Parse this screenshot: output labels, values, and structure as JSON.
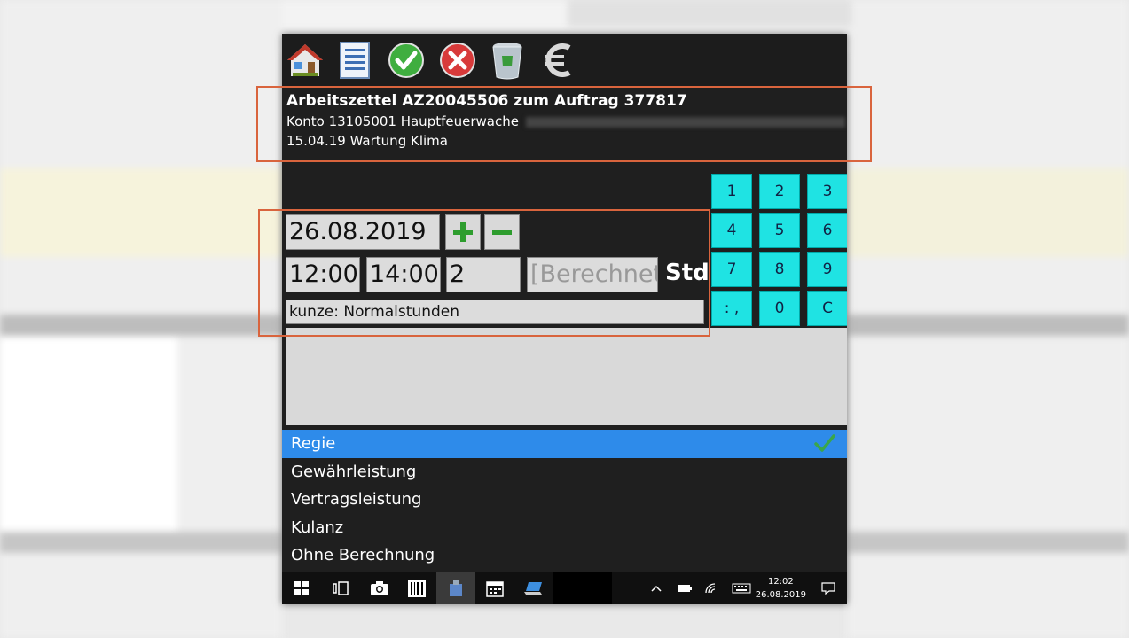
{
  "header": {
    "title": "Arbeitszettel AZ20045506 zum Auftrag 377817",
    "konto": "Konto 13105001 Hauptfeuerwache",
    "subtitle": "15.04.19 Wartung Klima"
  },
  "toolbar": {
    "icons": [
      "home-icon",
      "list-icon",
      "accept-icon",
      "cancel-icon",
      "trash-icon",
      "euro-icon"
    ]
  },
  "form": {
    "date": "26.08.2019",
    "start": "12:00",
    "end": "14:00",
    "duration": "2",
    "calc_placeholder": "[Berechnet]",
    "unit": "Std",
    "wage_type": "kunze: Normalstunden"
  },
  "keypad": [
    "1",
    "2",
    "3",
    "4",
    "5",
    "6",
    "7",
    "8",
    "9",
    ": ,",
    "0",
    "C"
  ],
  "billing_options": [
    {
      "label": "Regie",
      "selected": true
    },
    {
      "label": "Gewährleistung",
      "selected": false
    },
    {
      "label": "Vertragsleistung",
      "selected": false
    },
    {
      "label": "Kulanz",
      "selected": false
    },
    {
      "label": "Ohne Berechnung",
      "selected": false
    }
  ],
  "taskbar": {
    "time": "12:02",
    "date": "26.08.2019"
  },
  "colors": {
    "accent": "#2e8bea",
    "keypad": "#1fe3e3",
    "highlight_box": "#d9643d",
    "background": "#1f1f1f"
  }
}
